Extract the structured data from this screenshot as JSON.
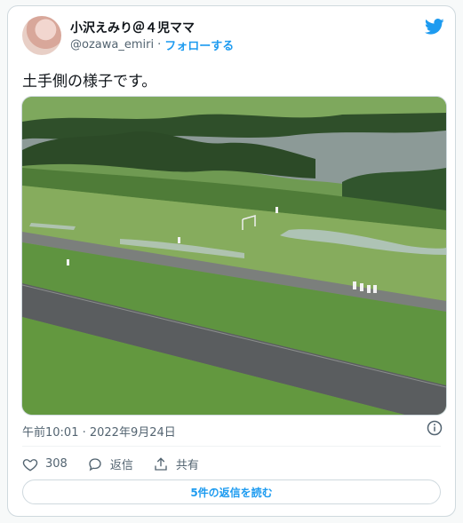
{
  "author": {
    "display_name": "小沢えみり＠４児ママ",
    "handle": "@ozawa_emiri",
    "separator": "·",
    "follow_label": "フォローする"
  },
  "tweet": {
    "text": "土手側の様子です。",
    "timestamp": "午前10:01 · 2022年9月24日"
  },
  "actions": {
    "likes": "308",
    "reply_label": "返信",
    "share_label": "共有"
  },
  "read_replies_label": "5件の返信を読む",
  "colors": {
    "accent": "#1d9bf0",
    "text_secondary": "#536471",
    "border": "#cfd9de"
  },
  "icons": [
    "twitter-bird-icon",
    "info-icon",
    "heart-icon",
    "reply-icon",
    "share-icon"
  ]
}
